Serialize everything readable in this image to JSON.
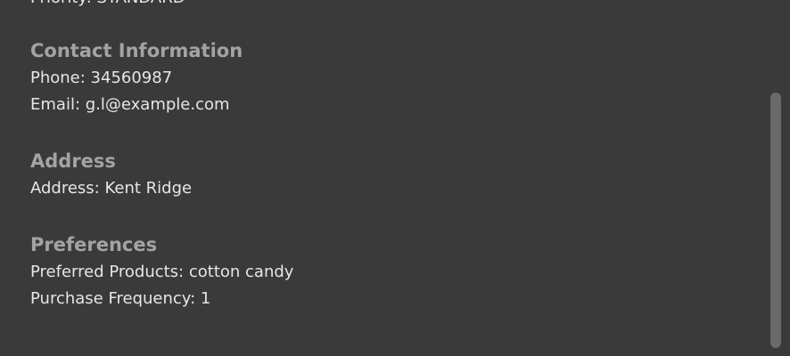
{
  "top_cut": {
    "text": "Priority: STANDARD"
  },
  "contact": {
    "title": "Contact Information",
    "phone": "Phone: 34560987",
    "email": "Email: g.l@example.com"
  },
  "address": {
    "title": "Address",
    "address": "Address: Kent Ridge"
  },
  "preferences": {
    "title": "Preferences",
    "products": "Preferred Products: cotton candy",
    "frequency": "Purchase Frequency: 1"
  }
}
